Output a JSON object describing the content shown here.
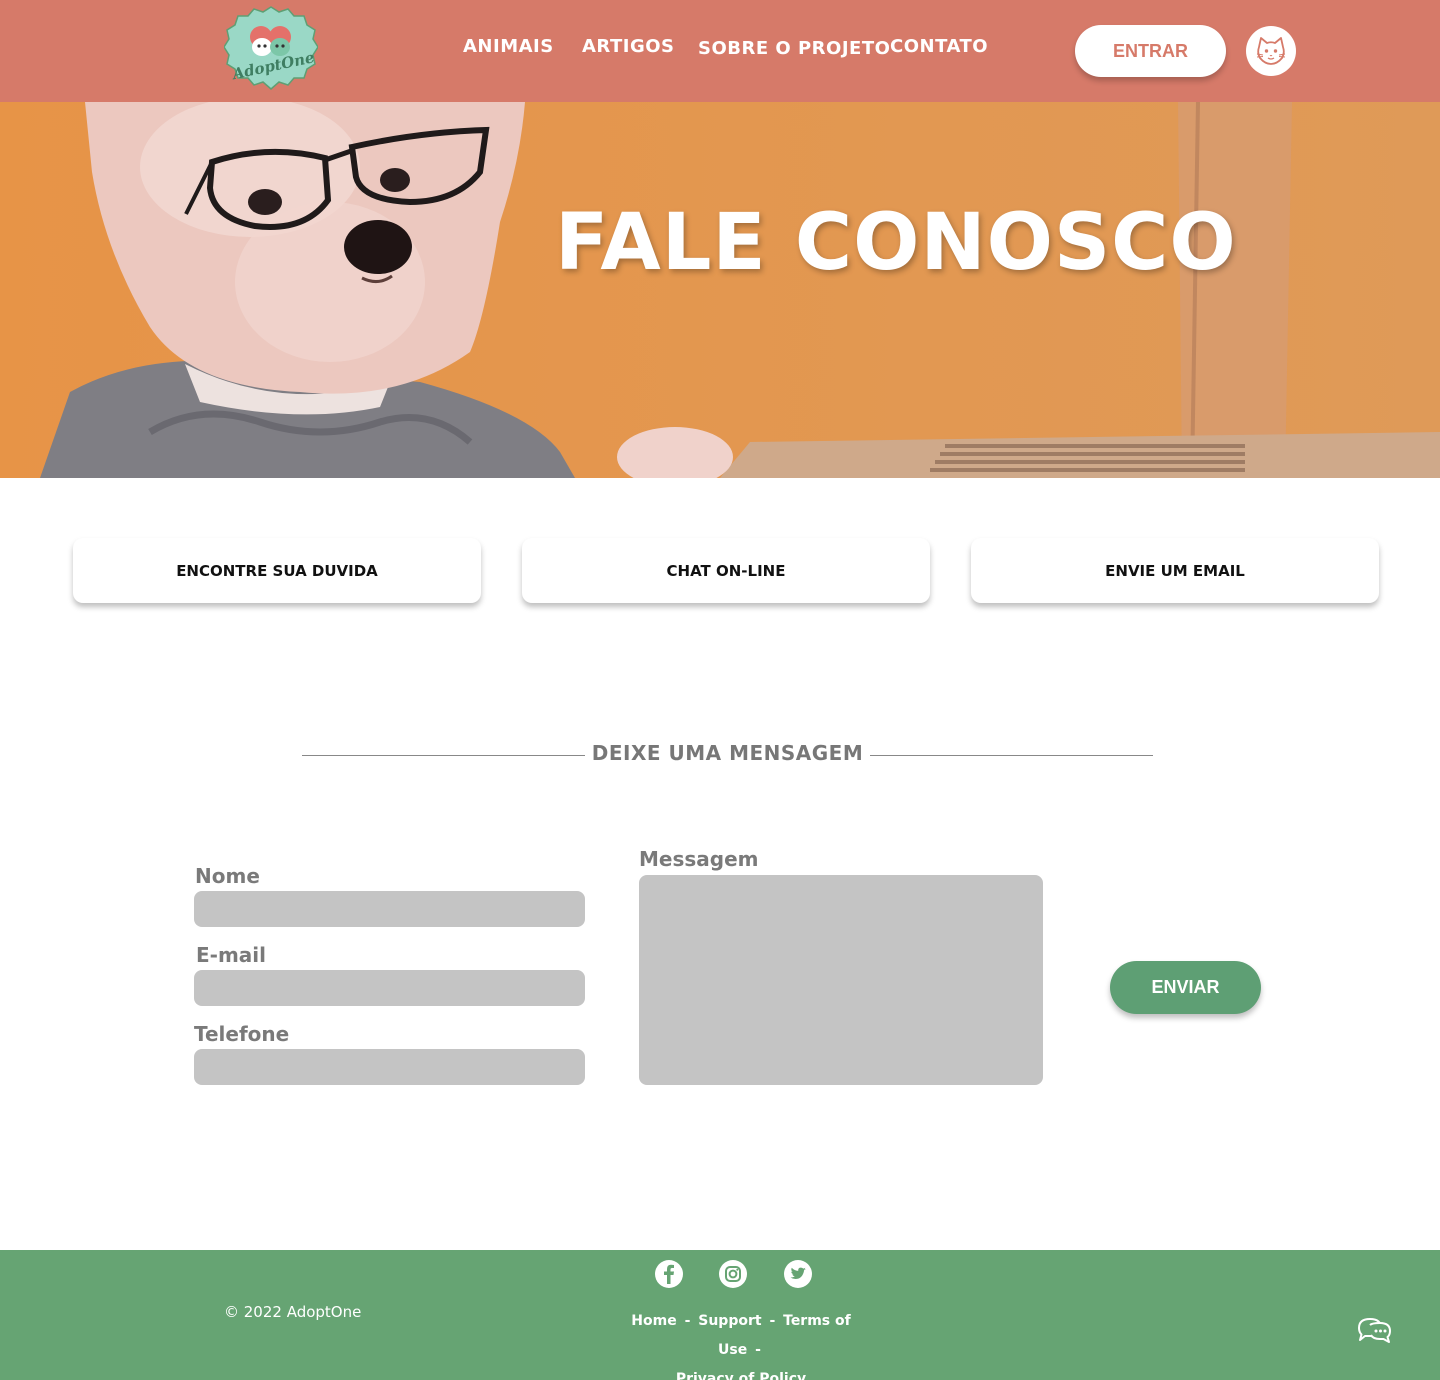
{
  "header": {
    "logo_text": "AdoptOne",
    "nav": [
      {
        "label": "ANIMAIS"
      },
      {
        "label": "ARTIGOS"
      },
      {
        "label": "SOBRE O PROJETO"
      },
      {
        "label": "CONTATO"
      }
    ],
    "login_label": "ENTRAR",
    "profile_icon": "cat-face-icon"
  },
  "hero": {
    "title": "FALE CONOSCO"
  },
  "options": [
    {
      "label": "ENCONTRE SUA DUVIDA"
    },
    {
      "label": "CHAT ON-LINE"
    },
    {
      "label": "ENVIE UM EMAIL"
    }
  ],
  "form": {
    "section_title": "DEIXE UMA MENSAGEM",
    "name_label": "Nome",
    "email_label": "E-mail",
    "phone_label": "Telefone",
    "message_label": "Messagem",
    "name_value": "",
    "email_value": "",
    "phone_value": "",
    "message_value": "",
    "submit_label": "ENVIAR"
  },
  "footer": {
    "copyright": "© 2022 AdoptOne",
    "social": [
      "facebook-icon",
      "instagram-icon",
      "twitter-icon"
    ],
    "links": [
      "Home",
      "Support",
      "Terms of Use",
      "Privacy of Policy"
    ],
    "separator": "-"
  },
  "colors": {
    "header_bg": "#d67a69",
    "hero_bg": "#df9651",
    "accent_green": "#5e9f74",
    "footer_bg": "#66a473",
    "input_bg": "#c4c4c4"
  }
}
